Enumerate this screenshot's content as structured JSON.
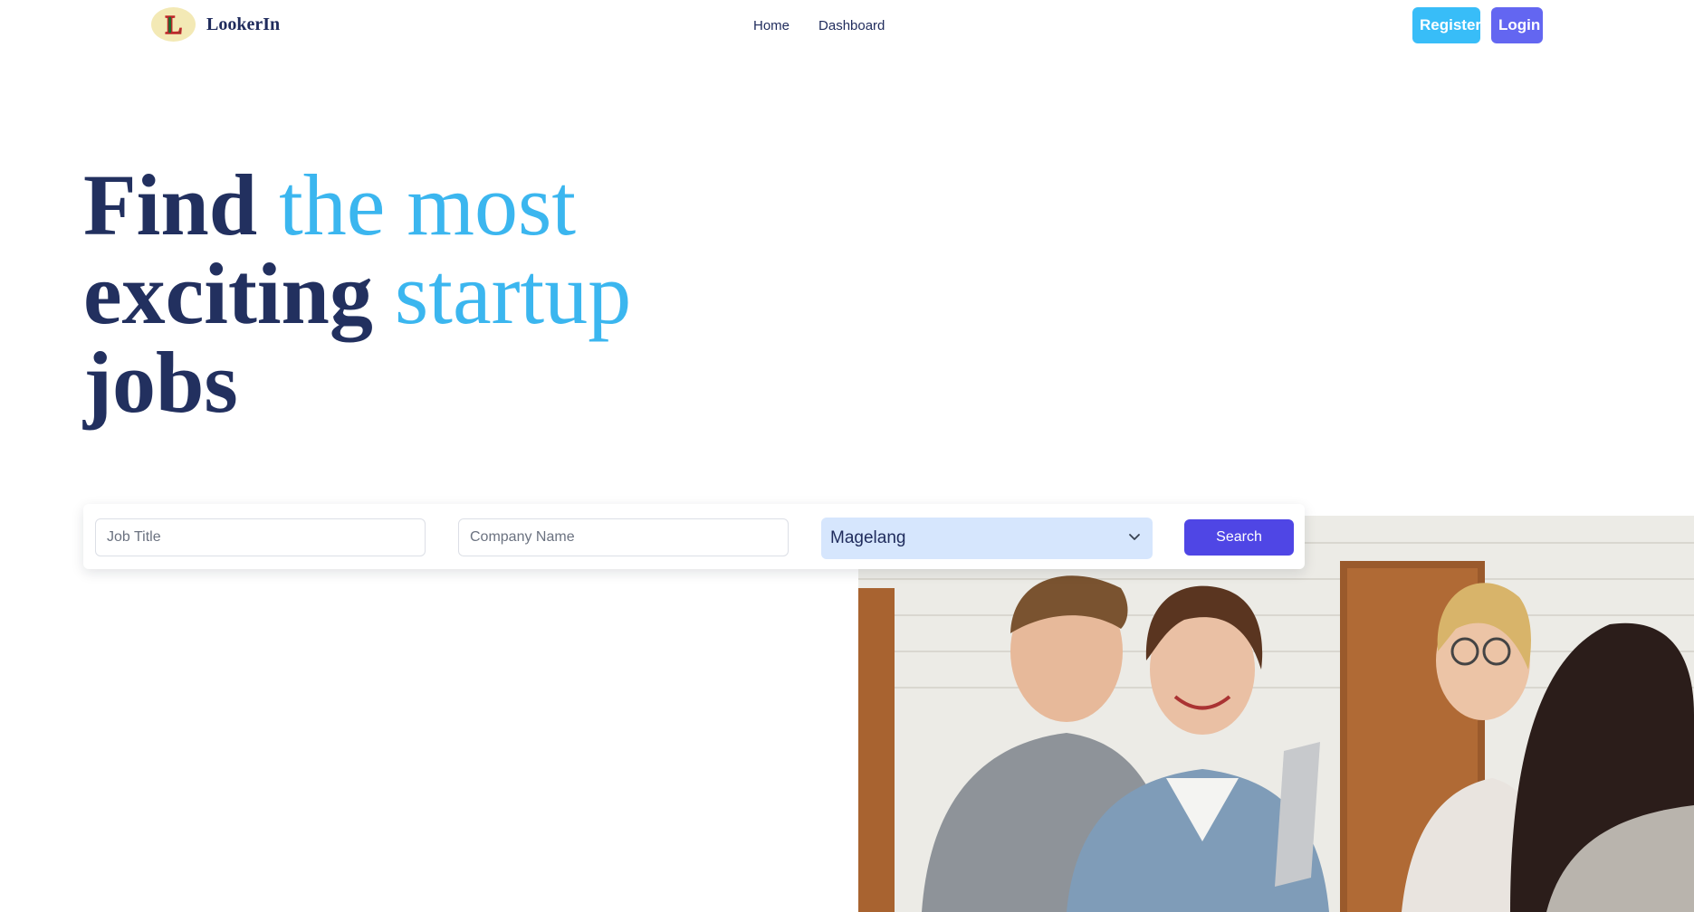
{
  "brand": {
    "name": "LookerIn",
    "logo_letter": "L"
  },
  "nav": {
    "links": [
      "Home",
      "Dashboard"
    ]
  },
  "auth": {
    "register_label": "Register",
    "login_label": "Login"
  },
  "hero": {
    "line1_dark": "Find",
    "line1_accent": "the most",
    "line2_dark": "exciting",
    "line2_accent": "startup",
    "line3_dark": "jobs"
  },
  "search": {
    "job_title_placeholder": "Job Title",
    "company_placeholder": "Company Name",
    "location_value": "Magelang",
    "button_label": "Search"
  },
  "colors": {
    "dark_text": "#22305f",
    "accent_blue": "#3bb6ef",
    "register_bg": "#38bdf8",
    "login_bg": "#6366f1",
    "search_bg": "#4f46e5",
    "select_bg": "#d6e6fd"
  },
  "icons": {
    "dropdown": "chevron-down-icon"
  }
}
